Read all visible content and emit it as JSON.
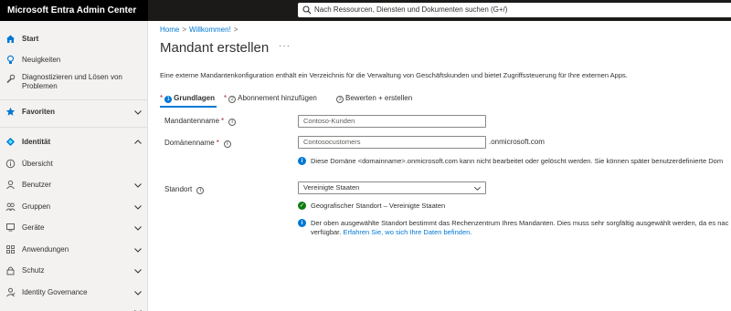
{
  "app": {
    "title": "Microsoft Entra Admin Center"
  },
  "search": {
    "placeholder": "Nach Ressourcen, Diensten und Dokumenten suchen (G+/)"
  },
  "sidebar": {
    "start": "Start",
    "neuigkeiten": "Neuigkeiten",
    "diagnose_line1": "Diagnostizieren und Lösen von",
    "diagnose_line2": "Problemen",
    "favoriten": "Favoriten",
    "identitaet": "Identität",
    "uebersicht": "Übersicht",
    "benutzer": "Benutzer",
    "gruppen": "Gruppen",
    "geraete": "Geräte",
    "anwendungen": "Anwendungen",
    "schutz": "Schutz",
    "identity_governance": "Identity Governance"
  },
  "breadcrumb": {
    "home": "Home",
    "sep": ">",
    "willkommen": "Willkommen!"
  },
  "page": {
    "title": "Mandant erstellen",
    "more": "···",
    "description": "Eine externe Mandantenkonfiguration enthält ein Verzeichnis für die Verwaltung von Geschäftskunden und bietet Zugriffssteuerung für Ihre externen Apps."
  },
  "tabs": [
    {
      "marker": "*",
      "number": "1",
      "label": "Grundlagen"
    },
    {
      "marker": "*",
      "number": "2",
      "label": "Abonnement hinzufügen"
    },
    {
      "marker": "",
      "number": "3",
      "label": "Bewerten + erstellen"
    }
  ],
  "form": {
    "mandantenname": {
      "label": "Mandantenname",
      "required": "*",
      "value": "Contoso-Kunden"
    },
    "domaenenname": {
      "label": "Domänenname",
      "required": "*",
      "value": "Contosocustomers",
      "suffix": ".onmicrosoft.com"
    },
    "domain_info": "Diese Domäne <domainname>.onmicrosoft.com kann nicht bearbeitet oder gelöscht werden. Sie können später benutzerdefinierte Dom",
    "standort": {
      "label": "Standort",
      "value": "Vereinigte Staaten"
    },
    "geo_success": "Geografischer Standort – Vereinigte Staaten",
    "standort_info_line1": "Der oben ausgewählte Standort bestimmt das Rechenzentrum Ihres Mandanten. Dies muss sehr sorgfältig ausgewählt werden, da es nac",
    "standort_info_line2_prefix": "verfügbar.",
    "standort_info_link": "Erfahren Sie, wo sich Ihre Daten befinden."
  },
  "icons": {
    "info_letter": "i",
    "check_letter": "✓"
  },
  "colors": {
    "accent": "#0078d4",
    "required": "#a4262c",
    "success": "#107c10",
    "topbar": "#1b1a19"
  }
}
